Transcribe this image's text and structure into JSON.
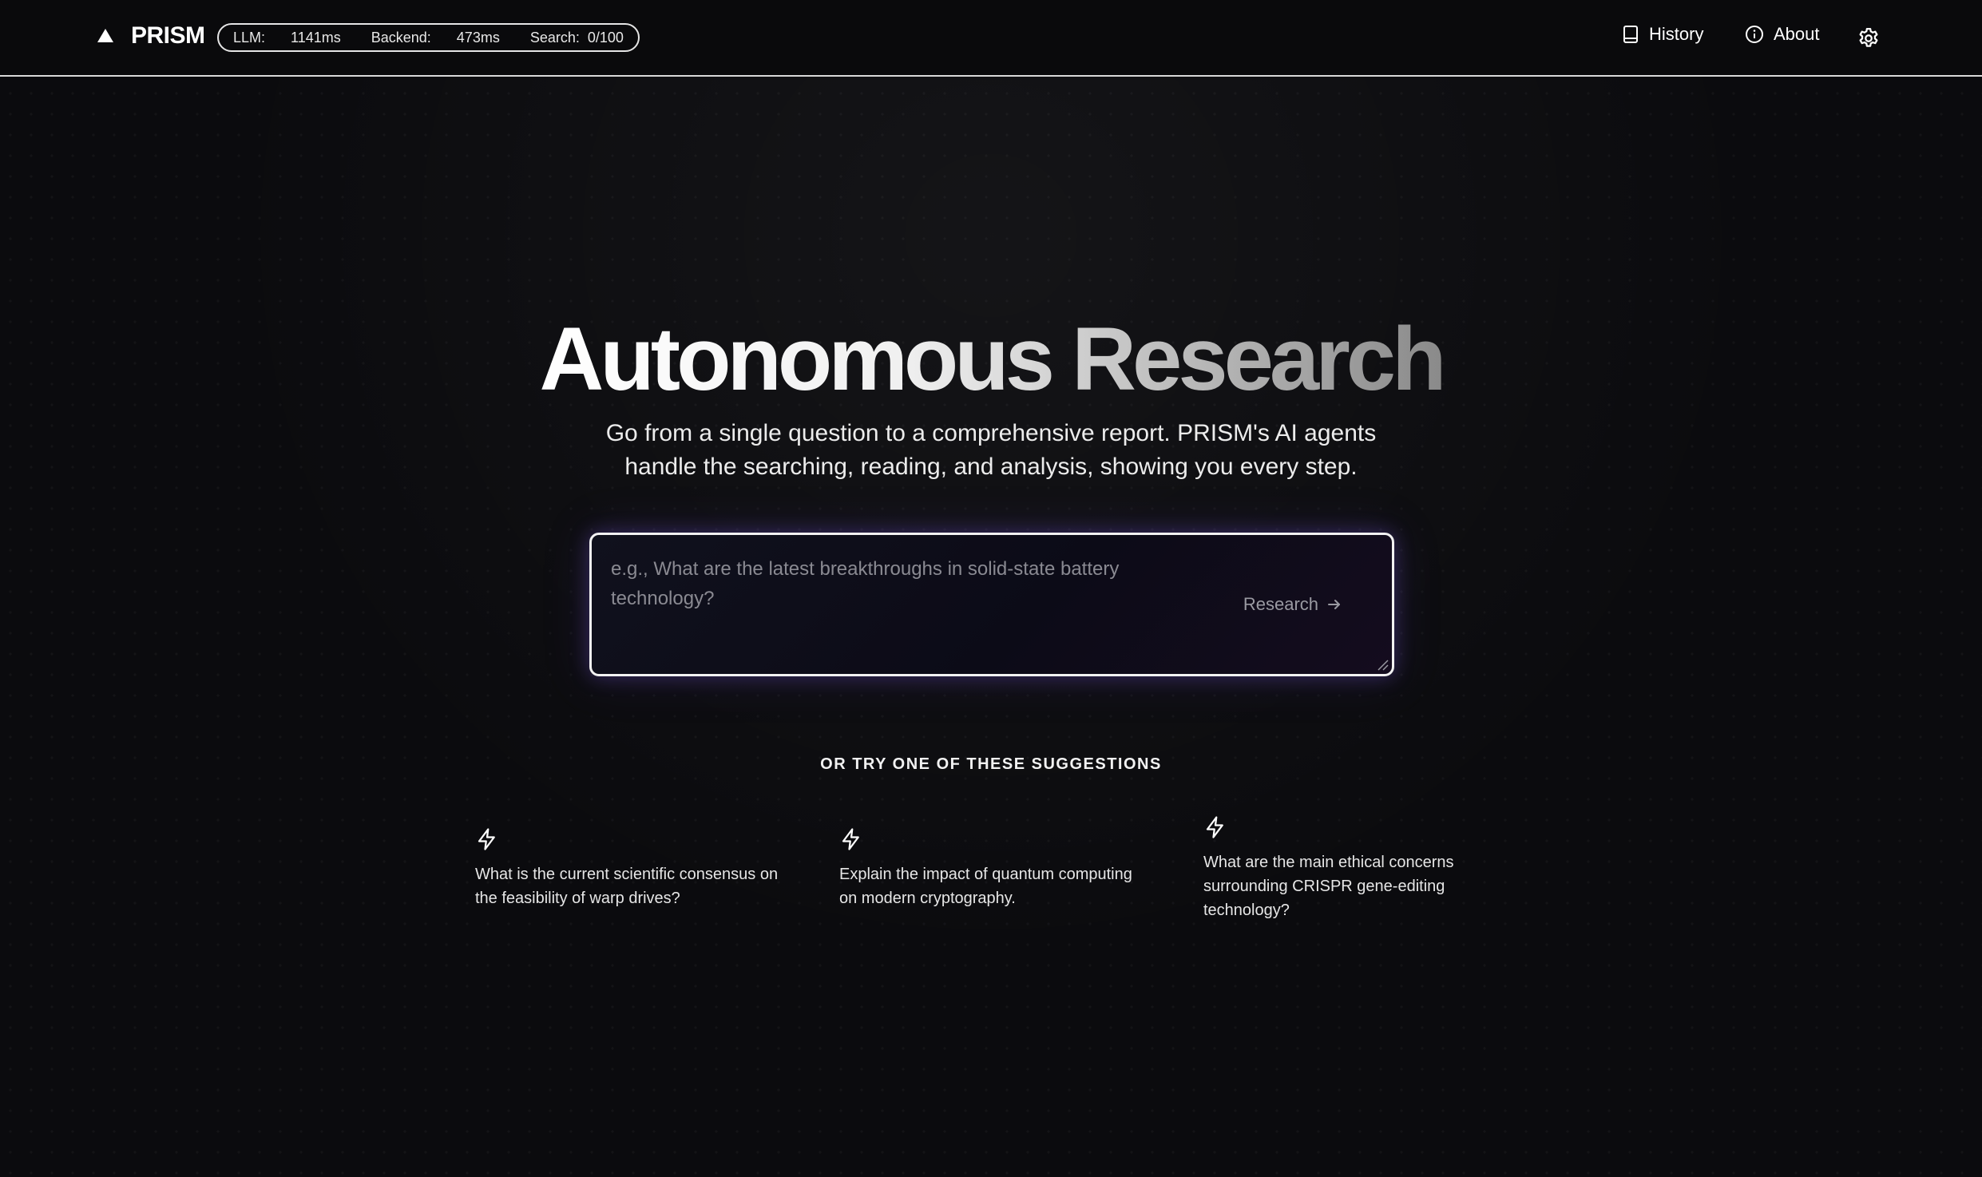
{
  "header": {
    "logo_text": "PRISM",
    "metrics": {
      "llm_label": "LLM:",
      "llm_value": "1141ms",
      "backend_label": "Backend:",
      "backend_value": "473ms",
      "search_label": "Search:",
      "search_value": "0/100"
    },
    "nav": {
      "history": "History",
      "about": "About"
    }
  },
  "hero": {
    "title": "Autonomous Research",
    "subtitle": "Go from a single question to a comprehensive report. PRISM's AI agents handle the searching, reading, and analysis, showing you every step."
  },
  "search": {
    "placeholder": "e.g., What are the latest breakthroughs in solid-state battery technology?",
    "value": "",
    "button_label": "Research"
  },
  "suggestions": {
    "heading": "OR TRY ONE OF THESE SUGGESTIONS",
    "items": [
      {
        "text": "What is the current scientific consensus on the feasibility of warp drives?",
        "icon": "lightning-icon"
      },
      {
        "text": "Explain the impact of quantum computing on modern cryptography.",
        "icon": "lightning-icon"
      },
      {
        "text": "What are the main ethical concerns surrounding CRISPR gene-editing technology?",
        "icon": "lightning-icon"
      }
    ]
  },
  "colors": {
    "background": "#0b0b0e",
    "text": "#ffffff",
    "accent_glow": "#7a5ae0"
  }
}
